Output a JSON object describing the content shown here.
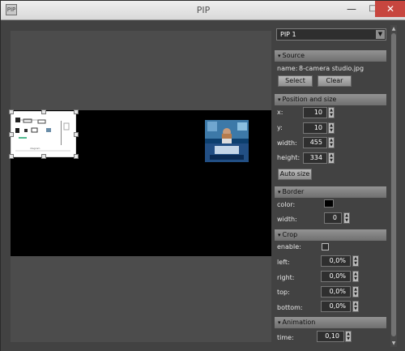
{
  "window": {
    "title": "PIP",
    "min_label": "—",
    "max_label": "□",
    "close_label": "✕",
    "app_icon": "PIP"
  },
  "preview": {
    "main_pip": "document-preview",
    "secondary_pip": "news-anchor-preview"
  },
  "panel": {
    "pip_select": "PIP 1",
    "source": {
      "header": "Source",
      "name_label": "name:",
      "name_value": "8-camera studio.jpg",
      "select_button": "Select",
      "clear_button": "Clear"
    },
    "position": {
      "header": "Position and size",
      "x_label": "x:",
      "x_value": "10",
      "y_label": "y:",
      "y_value": "10",
      "width_label": "width:",
      "width_value": "455",
      "height_label": "height:",
      "height_value": "334",
      "auto_button": "Auto size"
    },
    "border": {
      "header": "Border",
      "color_label": "color:",
      "color_value": "#000000",
      "width_label": "width:",
      "width_value": "0"
    },
    "crop": {
      "header": "Crop",
      "enable_label": "enable:",
      "enabled": false,
      "left_label": "left:",
      "left_value": "0,0%",
      "right_label": "right:",
      "right_value": "0,0%",
      "top_label": "top:",
      "top_value": "0,0%",
      "bottom_label": "bottom:",
      "bottom_value": "0,0%"
    },
    "animation": {
      "header": "Animation",
      "time_label": "time:",
      "time_value": "0,10"
    }
  },
  "colors": {
    "accent_close": "#c7463f",
    "panel_bg": "#424242",
    "canvas_bg": "#000000"
  }
}
